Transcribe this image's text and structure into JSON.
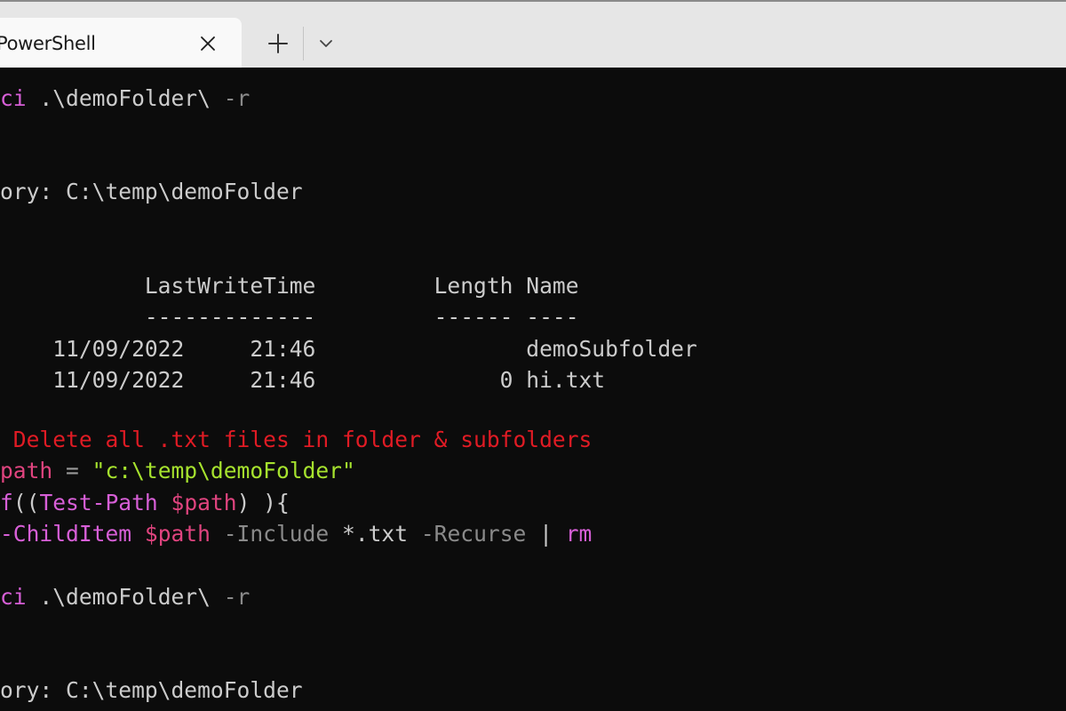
{
  "tab": {
    "title": "PowerShell"
  },
  "icons": {
    "close": "close-icon",
    "new_tab": "plus-icon",
    "dropdown": "chevron-down-icon"
  },
  "colors": {
    "background": "#0c0c0c",
    "titlebar": "#e6e6e6",
    "tab": "#f9f9f9",
    "function": "#d75fd7",
    "comment": "#e01b24",
    "variable": "#e0447f",
    "string": "#a6e22e",
    "parameter": "#8a8a8a",
    "text": "#cccccc"
  },
  "terminal": {
    "line1": {
      "cmd": "ci",
      "arg": " .\\demoFolder\\ ",
      "param": "-r"
    },
    "line2": {
      "text": "ory: C:\\temp\\demoFolder"
    },
    "header": {
      "text": "           LastWriteTime         Length Name"
    },
    "underline": {
      "text": "           -------------         ------ ----"
    },
    "row1": {
      "text": "    11/09/2022     21:46                demoSubfolder"
    },
    "row2": {
      "text": "    11/09/2022     21:46              0 hi.txt"
    },
    "comment": {
      "text": " Delete all .txt files in folder & subfolders"
    },
    "assign": {
      "var": "path",
      "op": " = ",
      "str": "\"c:\\temp\\demoFolder\""
    },
    "iftest": {
      "kw": "f",
      "open": "((",
      "fn": "Test-Path",
      "space": " ",
      "var": "$path",
      "close": ") ){"
    },
    "pipeline": {
      "fn": "-ChildItem",
      "space1": " ",
      "var": "$path",
      "param1": " -Include",
      "arg": " *.txt",
      "param2": " -Recurse",
      "pipe": " | ",
      "fn2": "rm"
    },
    "line3": {
      "cmd": "ci",
      "arg": " .\\demoFolder\\ ",
      "param": "-r"
    },
    "line4": {
      "text": "ory: C:\\temp\\demoFolder"
    }
  }
}
